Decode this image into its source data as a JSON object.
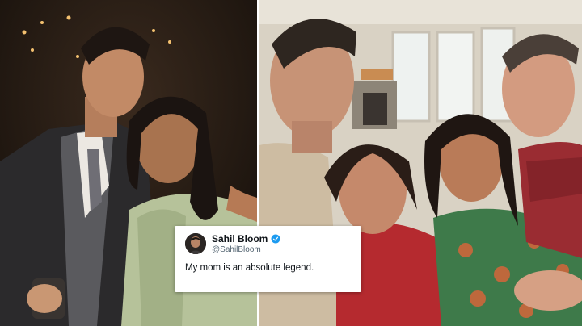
{
  "tweet": {
    "display_name": "Sahil Bloom",
    "handle": "@SahilBloom",
    "text": "My mom is an absolute legend.",
    "avatar_icon": "profile-photo",
    "verified_icon": "verified-badge-icon",
    "verified_color": "#1d9bf0"
  },
  "photos": {
    "left": "evening-portrait-son-and-mother",
    "right": "family-selfie-indoors"
  }
}
